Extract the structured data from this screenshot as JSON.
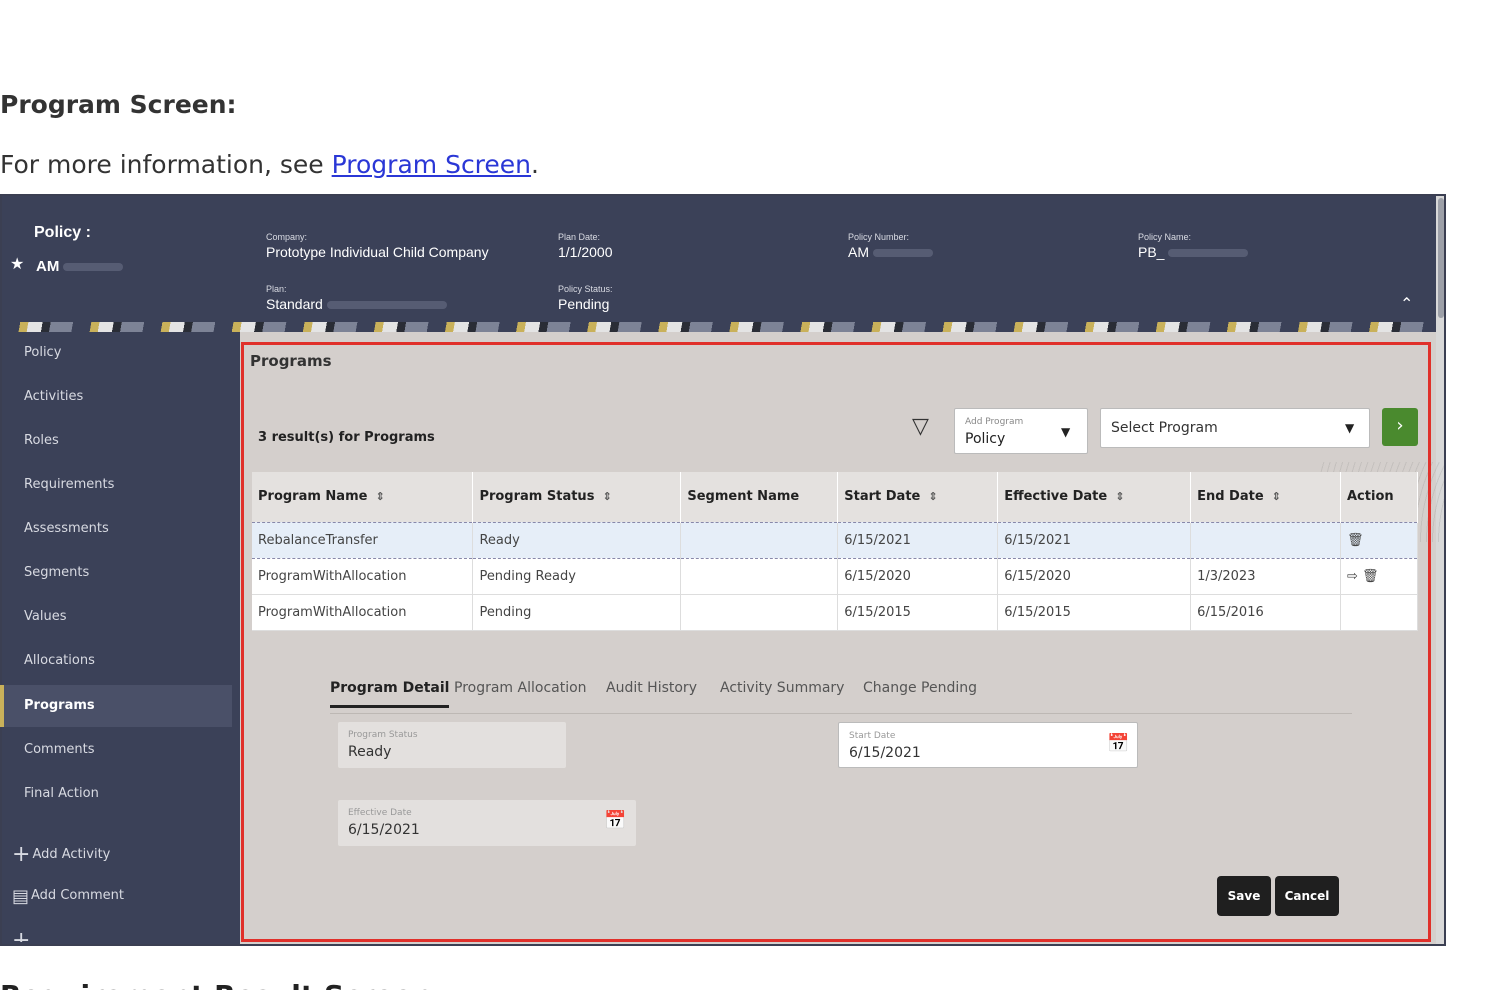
{
  "doc": {
    "heading": "Program Screen:",
    "intro_prefix": "For more information, see ",
    "intro_link": "Program Screen",
    "intro_suffix": ".",
    "next_heading": "Requirement Result Screen"
  },
  "header": {
    "policy_label": "Policy :",
    "policy_id": "AM",
    "company_label": "Company:",
    "company_value": "Prototype Individual Child Company",
    "plan_date_label": "Plan Date:",
    "plan_date_value": "1/1/2000",
    "policy_number_label": "Policy Number:",
    "policy_number_value": "AM",
    "policy_name_label": "Policy Name:",
    "policy_name_value": "PB_",
    "plan_label": "Plan:",
    "plan_value": "Standard",
    "policy_status_label": "Policy Status:",
    "policy_status_value": "Pending",
    "collapse_icon": "chevron-up-icon"
  },
  "sidebar": {
    "items": [
      {
        "label": "Policy"
      },
      {
        "label": "Activities"
      },
      {
        "label": "Roles"
      },
      {
        "label": "Requirements"
      },
      {
        "label": "Assessments"
      },
      {
        "label": "Segments"
      },
      {
        "label": "Values"
      },
      {
        "label": "Allocations"
      },
      {
        "label": "Programs",
        "active": true
      },
      {
        "label": "Comments"
      },
      {
        "label": "Final Action"
      }
    ],
    "add_activity": "Add Activity",
    "add_comment": "Add Comment"
  },
  "programs": {
    "title": "Programs",
    "result_count": "3 result(s) for Programs",
    "add_program_label": "Add Program",
    "add_program_value": "Policy",
    "select_program_placeholder": "Select Program",
    "columns": [
      "Program Name",
      "Program Status",
      "Segment Name",
      "Start Date",
      "Effective Date",
      "End Date",
      "Action"
    ],
    "rows": [
      {
        "name": "RebalanceTransfer",
        "status": "Ready",
        "segment": "",
        "start": "6/15/2021",
        "effective": "6/15/2021",
        "end": "",
        "actions": "delete"
      },
      {
        "name": "ProgramWithAllocation",
        "status": "Pending Ready",
        "segment": "",
        "start": "6/15/2020",
        "effective": "6/15/2020",
        "end": "1/3/2023",
        "actions": "forward+delete"
      },
      {
        "name": "ProgramWithAllocation",
        "status": "Pending",
        "segment": "",
        "start": "6/15/2015",
        "effective": "6/15/2015",
        "end": "6/15/2016",
        "actions": ""
      }
    ]
  },
  "detail": {
    "tabs": [
      "Program Detail",
      "Program Allocation",
      "Audit History",
      "Activity Summary",
      "Change Pending"
    ],
    "active_tab": "Program Detail",
    "program_status_label": "Program Status",
    "program_status_value": "Ready",
    "start_date_label": "Start Date",
    "start_date_value": "6/15/2021",
    "effective_date_label": "Effective Date",
    "effective_date_value": "6/15/2021",
    "save_label": "Save",
    "cancel_label": "Cancel"
  },
  "colors": {
    "header_bg": "#3b4158",
    "content_bg": "#d4cfcc",
    "highlight_border": "#e0302a",
    "go_button": "#4a8a2e"
  }
}
